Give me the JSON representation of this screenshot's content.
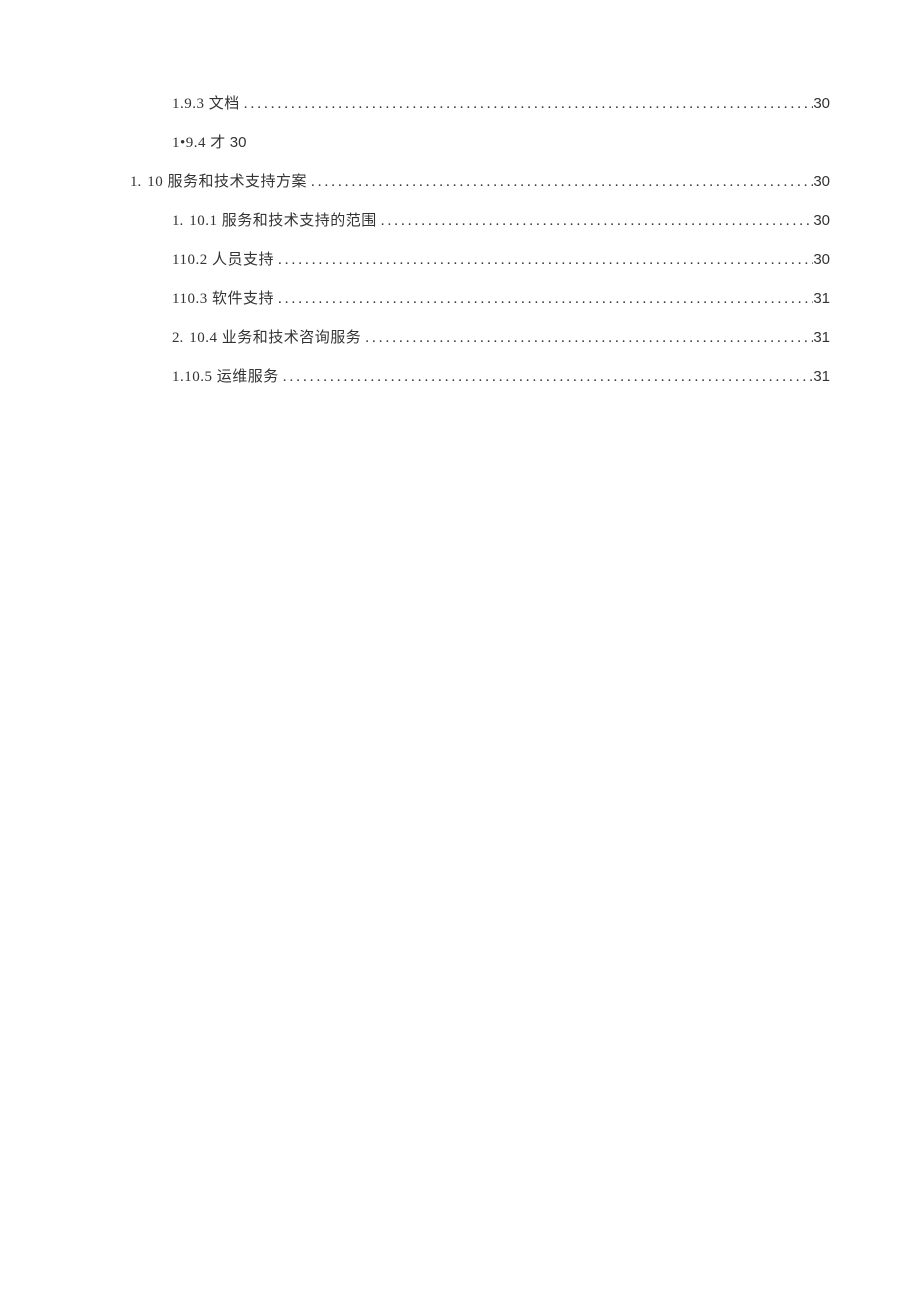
{
  "toc": [
    {
      "indent": 1,
      "marker": "",
      "label": "1.9.3 文档",
      "page": "30",
      "dots": true
    },
    {
      "indent": 1,
      "marker": "",
      "label": "1•9.4 才",
      "page": "30",
      "dots": false
    },
    {
      "indent": 0,
      "marker": "1.",
      "label": "10 服务和技术支持方案",
      "page": "30",
      "dots": true
    },
    {
      "indent": 1,
      "marker": "1.",
      "label": "10.1 服务和技术支持的范围",
      "page": "30",
      "dots": true
    },
    {
      "indent": 1,
      "marker": "",
      "label": "110.2 人员支持",
      "page": "30",
      "dots": true
    },
    {
      "indent": 1,
      "marker": "",
      "label": "110.3 软件支持",
      "page": "31",
      "dots": true
    },
    {
      "indent": 1,
      "marker": "2.",
      "label": "10.4 业务和技术咨询服务",
      "page": "31",
      "dots": true
    },
    {
      "indent": 1,
      "marker": "",
      "label": "1.10.5 运维服务",
      "page": "31",
      "dots": true
    }
  ]
}
